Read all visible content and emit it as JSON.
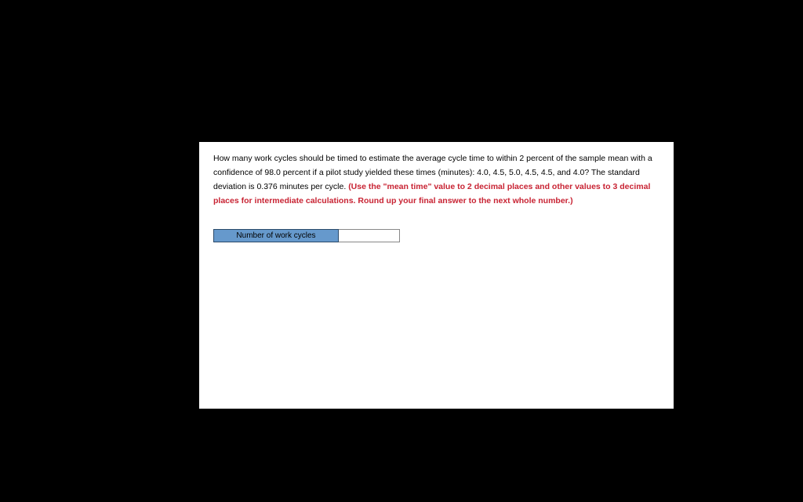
{
  "question": {
    "body_part1": "How many work cycles should be timed to estimate the average cycle time to within 2 percent of the sample mean with a confidence of 98.0 percent if a pilot study yielded these times (minutes): 4.0, 4.5, 5.0, 4.5, 4.5, and 4.0? The standard deviation is 0.376 minutes per cycle. ",
    "instruction": "(Use the \"mean time\" value to 2 decimal places and other values to 3 decimal places for intermediate calculations. Round up your final answer to the next whole number.)"
  },
  "answer": {
    "label": "Number of work cycles",
    "value": ""
  }
}
